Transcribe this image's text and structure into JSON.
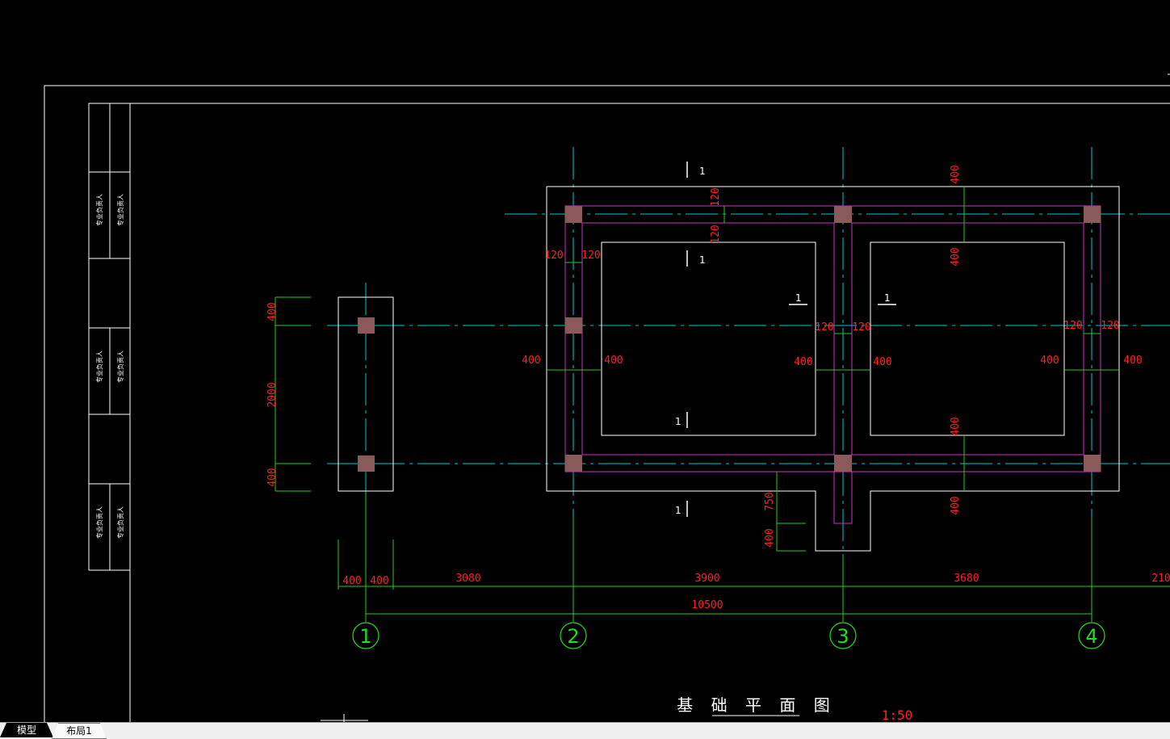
{
  "drawing": {
    "title": "基 础 平 面 图",
    "scale": "1:50",
    "axes": [
      "1",
      "2",
      "3",
      "4"
    ],
    "overall_dimension": "10500",
    "bay_dimensions": [
      "400",
      "400",
      "3080",
      "3900",
      "3680",
      "210"
    ],
    "left_pit_dimensions": [
      "400",
      "2000",
      "400"
    ],
    "wall_thickness_labels": [
      "120",
      "120",
      "120",
      "120",
      "120",
      "120",
      "120",
      "120"
    ],
    "offset_labels": [
      "400",
      "400",
      "400",
      "400",
      "400",
      "400",
      "400",
      "400",
      "400",
      "400",
      "400"
    ],
    "step_labels": [
      "750",
      "400"
    ],
    "section_marks": [
      "1",
      "1",
      "1",
      "1",
      "1",
      "1"
    ]
  },
  "title_block": {
    "cells": [
      "专业负责人",
      "专业负责人",
      "专业负责人",
      "专业负责人",
      "专业负责人",
      "专业负责人"
    ]
  },
  "colors": {
    "background": "#000000",
    "frame": "#ffffff",
    "axis_line": "#00c8c8",
    "dimension_line": "#22cc22",
    "dimension_text": "#ff2020",
    "beam": "#cc33cc",
    "column": "#8a5a5a"
  },
  "layout_tabs": [
    {
      "label": "模型",
      "active": true
    },
    {
      "label": "布局1",
      "active": false
    }
  ]
}
